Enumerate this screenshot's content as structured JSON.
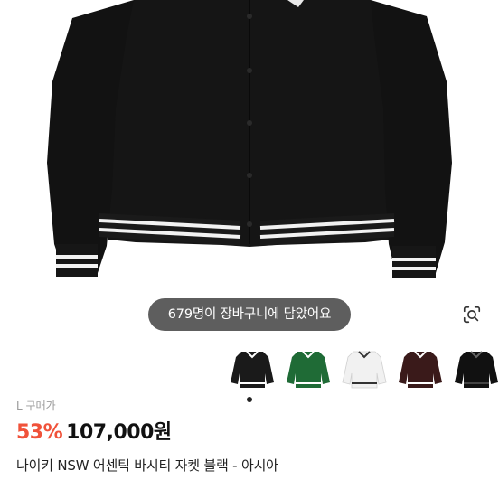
{
  "cart_toast": "679명이 장바구니에 담았어요",
  "price_label": "L 구매가",
  "discount": "53%",
  "price": "107,000원",
  "product_title": "나이키 NSW 어센틱 바시티 자켓 블랙 - 아시아",
  "colors": {
    "discount": "#f0523a",
    "toast_bg": "#505050"
  },
  "variants": [
    {
      "name": "black-white-trim",
      "body": "#1a1a1a",
      "sleeve": "#1a1a1a",
      "stripe": "#ffffff"
    },
    {
      "name": "green",
      "body": "#1f6b36",
      "sleeve": "#1f6b36",
      "stripe": "#ffffff"
    },
    {
      "name": "white",
      "body": "#f2f2f2",
      "sleeve": "#f2f2f2",
      "stripe": "#222222"
    },
    {
      "name": "burgundy",
      "body": "#3a1a1a",
      "sleeve": "#3a1a1a",
      "stripe": "#ffffff"
    },
    {
      "name": "black",
      "body": "#111111",
      "sleeve": "#111111",
      "stripe": "#333333"
    }
  ]
}
